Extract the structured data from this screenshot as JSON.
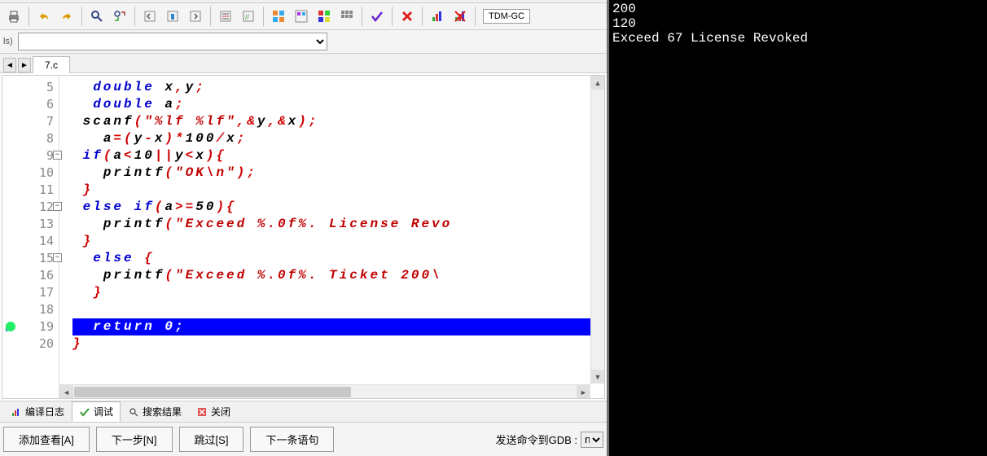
{
  "compiler_label": "TDM-GC",
  "selectbar_label": "ls)",
  "tab_name": "7.c",
  "gutter": [
    {
      "n": "5"
    },
    {
      "n": "6"
    },
    {
      "n": "7"
    },
    {
      "n": "8"
    },
    {
      "n": "9",
      "fold": true
    },
    {
      "n": "10"
    },
    {
      "n": "11"
    },
    {
      "n": "12",
      "fold": true
    },
    {
      "n": "13"
    },
    {
      "n": "14"
    },
    {
      "n": "15",
      "fold": true
    },
    {
      "n": "16"
    },
    {
      "n": "17"
    },
    {
      "n": "18"
    },
    {
      "n": "19",
      "current": true
    },
    {
      "n": "20"
    }
  ],
  "bottom_tabs": {
    "compile_log": "编译日志",
    "debug": "调试",
    "search": "搜索结果",
    "close": "关闭"
  },
  "debug_buttons": {
    "add_watch": "添加查看[A]",
    "next": "下一步[N]",
    "step": "跳过[S]",
    "next_stmt": "下一条语句"
  },
  "gdb_label": "发送命令到GDB :",
  "gdb_value": "n",
  "console": "200\n120\nExceed 67 License Revoked"
}
